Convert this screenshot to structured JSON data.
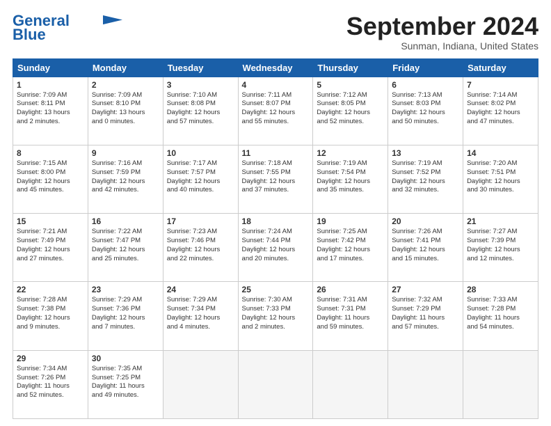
{
  "header": {
    "logo_line1": "General",
    "logo_line2": "Blue",
    "month": "September 2024",
    "location": "Sunman, Indiana, United States"
  },
  "days_of_week": [
    "Sunday",
    "Monday",
    "Tuesday",
    "Wednesday",
    "Thursday",
    "Friday",
    "Saturday"
  ],
  "weeks": [
    [
      {
        "day": 1,
        "lines": [
          "Sunrise: 7:09 AM",
          "Sunset: 8:11 PM",
          "Daylight: 13 hours",
          "and 2 minutes."
        ]
      },
      {
        "day": 2,
        "lines": [
          "Sunrise: 7:09 AM",
          "Sunset: 8:10 PM",
          "Daylight: 13 hours",
          "and 0 minutes."
        ]
      },
      {
        "day": 3,
        "lines": [
          "Sunrise: 7:10 AM",
          "Sunset: 8:08 PM",
          "Daylight: 12 hours",
          "and 57 minutes."
        ]
      },
      {
        "day": 4,
        "lines": [
          "Sunrise: 7:11 AM",
          "Sunset: 8:07 PM",
          "Daylight: 12 hours",
          "and 55 minutes."
        ]
      },
      {
        "day": 5,
        "lines": [
          "Sunrise: 7:12 AM",
          "Sunset: 8:05 PM",
          "Daylight: 12 hours",
          "and 52 minutes."
        ]
      },
      {
        "day": 6,
        "lines": [
          "Sunrise: 7:13 AM",
          "Sunset: 8:03 PM",
          "Daylight: 12 hours",
          "and 50 minutes."
        ]
      },
      {
        "day": 7,
        "lines": [
          "Sunrise: 7:14 AM",
          "Sunset: 8:02 PM",
          "Daylight: 12 hours",
          "and 47 minutes."
        ]
      }
    ],
    [
      {
        "day": 8,
        "lines": [
          "Sunrise: 7:15 AM",
          "Sunset: 8:00 PM",
          "Daylight: 12 hours",
          "and 45 minutes."
        ]
      },
      {
        "day": 9,
        "lines": [
          "Sunrise: 7:16 AM",
          "Sunset: 7:59 PM",
          "Daylight: 12 hours",
          "and 42 minutes."
        ]
      },
      {
        "day": 10,
        "lines": [
          "Sunrise: 7:17 AM",
          "Sunset: 7:57 PM",
          "Daylight: 12 hours",
          "and 40 minutes."
        ]
      },
      {
        "day": 11,
        "lines": [
          "Sunrise: 7:18 AM",
          "Sunset: 7:55 PM",
          "Daylight: 12 hours",
          "and 37 minutes."
        ]
      },
      {
        "day": 12,
        "lines": [
          "Sunrise: 7:19 AM",
          "Sunset: 7:54 PM",
          "Daylight: 12 hours",
          "and 35 minutes."
        ]
      },
      {
        "day": 13,
        "lines": [
          "Sunrise: 7:19 AM",
          "Sunset: 7:52 PM",
          "Daylight: 12 hours",
          "and 32 minutes."
        ]
      },
      {
        "day": 14,
        "lines": [
          "Sunrise: 7:20 AM",
          "Sunset: 7:51 PM",
          "Daylight: 12 hours",
          "and 30 minutes."
        ]
      }
    ],
    [
      {
        "day": 15,
        "lines": [
          "Sunrise: 7:21 AM",
          "Sunset: 7:49 PM",
          "Daylight: 12 hours",
          "and 27 minutes."
        ]
      },
      {
        "day": 16,
        "lines": [
          "Sunrise: 7:22 AM",
          "Sunset: 7:47 PM",
          "Daylight: 12 hours",
          "and 25 minutes."
        ]
      },
      {
        "day": 17,
        "lines": [
          "Sunrise: 7:23 AM",
          "Sunset: 7:46 PM",
          "Daylight: 12 hours",
          "and 22 minutes."
        ]
      },
      {
        "day": 18,
        "lines": [
          "Sunrise: 7:24 AM",
          "Sunset: 7:44 PM",
          "Daylight: 12 hours",
          "and 20 minutes."
        ]
      },
      {
        "day": 19,
        "lines": [
          "Sunrise: 7:25 AM",
          "Sunset: 7:42 PM",
          "Daylight: 12 hours",
          "and 17 minutes."
        ]
      },
      {
        "day": 20,
        "lines": [
          "Sunrise: 7:26 AM",
          "Sunset: 7:41 PM",
          "Daylight: 12 hours",
          "and 15 minutes."
        ]
      },
      {
        "day": 21,
        "lines": [
          "Sunrise: 7:27 AM",
          "Sunset: 7:39 PM",
          "Daylight: 12 hours",
          "and 12 minutes."
        ]
      }
    ],
    [
      {
        "day": 22,
        "lines": [
          "Sunrise: 7:28 AM",
          "Sunset: 7:38 PM",
          "Daylight: 12 hours",
          "and 9 minutes."
        ]
      },
      {
        "day": 23,
        "lines": [
          "Sunrise: 7:29 AM",
          "Sunset: 7:36 PM",
          "Daylight: 12 hours",
          "and 7 minutes."
        ]
      },
      {
        "day": 24,
        "lines": [
          "Sunrise: 7:29 AM",
          "Sunset: 7:34 PM",
          "Daylight: 12 hours",
          "and 4 minutes."
        ]
      },
      {
        "day": 25,
        "lines": [
          "Sunrise: 7:30 AM",
          "Sunset: 7:33 PM",
          "Daylight: 12 hours",
          "and 2 minutes."
        ]
      },
      {
        "day": 26,
        "lines": [
          "Sunrise: 7:31 AM",
          "Sunset: 7:31 PM",
          "Daylight: 11 hours",
          "and 59 minutes."
        ]
      },
      {
        "day": 27,
        "lines": [
          "Sunrise: 7:32 AM",
          "Sunset: 7:29 PM",
          "Daylight: 11 hours",
          "and 57 minutes."
        ]
      },
      {
        "day": 28,
        "lines": [
          "Sunrise: 7:33 AM",
          "Sunset: 7:28 PM",
          "Daylight: 11 hours",
          "and 54 minutes."
        ]
      }
    ],
    [
      {
        "day": 29,
        "lines": [
          "Sunrise: 7:34 AM",
          "Sunset: 7:26 PM",
          "Daylight: 11 hours",
          "and 52 minutes."
        ]
      },
      {
        "day": 30,
        "lines": [
          "Sunrise: 7:35 AM",
          "Sunset: 7:25 PM",
          "Daylight: 11 hours",
          "and 49 minutes."
        ]
      },
      null,
      null,
      null,
      null,
      null
    ]
  ]
}
